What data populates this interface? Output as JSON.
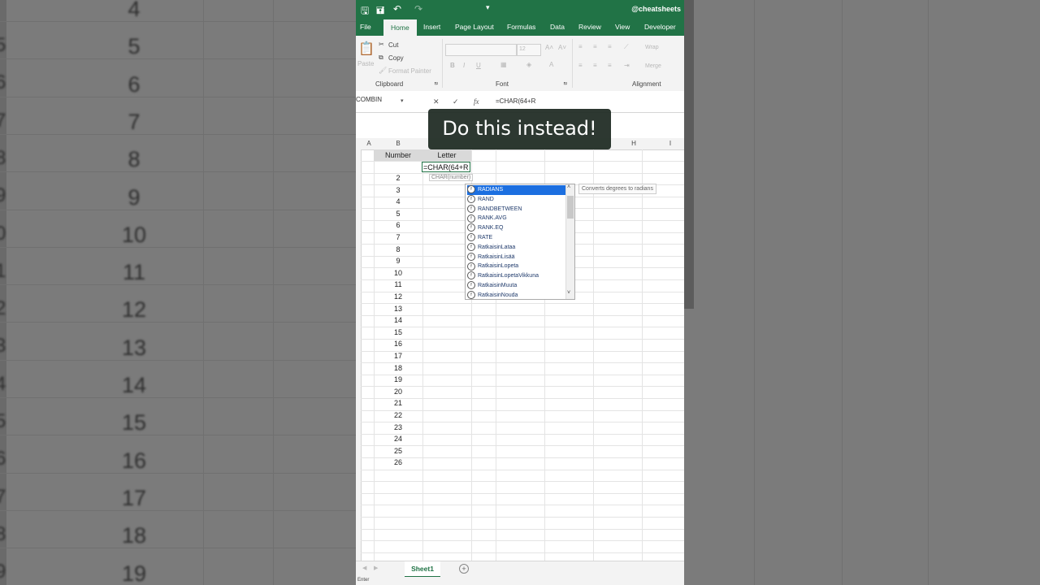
{
  "background": {
    "left_row_numbers": [
      "4",
      "5",
      "6",
      "7",
      "8",
      "9",
      "10",
      "11",
      "12",
      "13",
      "14",
      "15",
      "16",
      "17",
      "18",
      "19"
    ],
    "left_row_headers": [
      "5",
      "6",
      "7",
      "8",
      "9",
      "0",
      "1",
      "2",
      "3",
      "4",
      "5",
      "6",
      "7",
      "8",
      "9"
    ]
  },
  "qat": {
    "handle": "@cheatsheets"
  },
  "tabs": [
    "File",
    "Home",
    "Insert",
    "Page Layout",
    "Formulas",
    "Data",
    "Review",
    "View",
    "Developer"
  ],
  "ribbon": {
    "paste": "Paste",
    "cut": "Cut",
    "copy": "Copy",
    "format_painter": "Format Painter",
    "clipboard_group": "Clipboard",
    "font_size": "12",
    "bold": "B",
    "italic": "I",
    "underline": "U",
    "font_group": "Font",
    "wrap": "Wrap",
    "merge": "Merge",
    "alignment_group": "Alignment"
  },
  "formula_bar": {
    "name_box": "COMBIN",
    "cancel": "✕",
    "enter": "✓",
    "fx": "fx",
    "formula": "=CHAR(64+R"
  },
  "banner": "Do this instead!",
  "columns": [
    "A",
    "B",
    "H",
    "I"
  ],
  "headers": {
    "number": "Number",
    "letter": "Letter"
  },
  "editing_cell": "=CHAR(64+R",
  "tooltip": "CHAR(number)",
  "row_values": [
    "2",
    "3",
    "4",
    "5",
    "6",
    "7",
    "8",
    "9",
    "10",
    "11",
    "12",
    "13",
    "14",
    "15",
    "16",
    "17",
    "18",
    "19",
    "20",
    "21",
    "22",
    "23",
    "24",
    "25",
    "26"
  ],
  "autocomplete": {
    "items": [
      "RADIANS",
      "RAND",
      "RANDBETWEEN",
      "RANK.AVG",
      "RANK.EQ",
      "RATE",
      "RatkaisinLataa",
      "RatkaisinLisää",
      "RatkaisinLopeta",
      "RatkaisinLopetaVikkuna",
      "RatkaisinMuuta",
      "RatkaisinNouda"
    ],
    "selected_index": 0,
    "description": "Converts degrees to radians"
  },
  "sheet_tab": "Sheet1",
  "status": "Enter"
}
